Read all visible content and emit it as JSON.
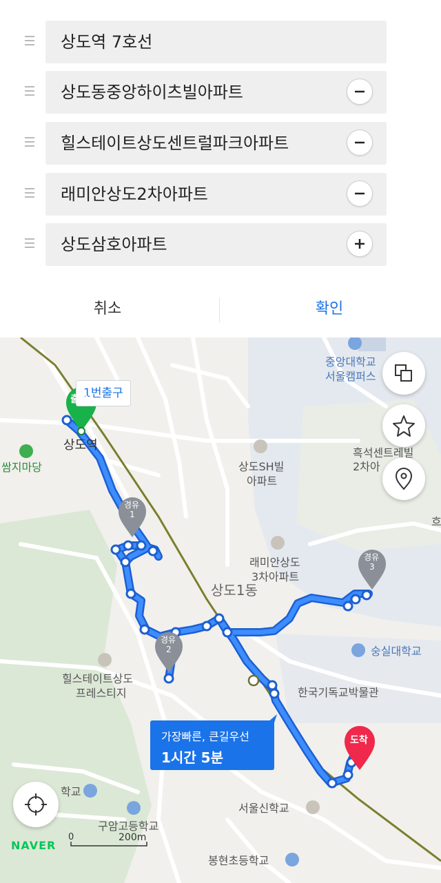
{
  "waypoints": [
    {
      "name": "상도역 7호선",
      "button": ""
    },
    {
      "name": "상도동중앙하이츠빌아파트",
      "button": "minus"
    },
    {
      "name": "힐스테이트상도센트럴파크아파트",
      "button": "minus"
    },
    {
      "name": "래미안상도2차아파트",
      "button": "minus"
    },
    {
      "name": "상도삼호아파트",
      "button": "plus"
    }
  ],
  "actions": {
    "cancel": "취소",
    "confirm": "확인"
  },
  "colors": {
    "accent": "#1a73e8",
    "route": "#1e6ff0",
    "start": "#19b14a",
    "end": "#f0284b",
    "via": "#8a8f98",
    "confirm": "#1a73e8"
  },
  "map": {
    "labels": {
      "exit": "1번출구",
      "station": "상도역",
      "ssamji": "쌈지마당",
      "chungang1": "중앙대학교",
      "chungang2": "서울캠퍼스",
      "heukseok1": "흑석센트레빌",
      "heukseok2": "2차아",
      "sangdo_sh1": "상도SH빌",
      "sangdo_sh2": "아파트",
      "raemian1": "래미안상도",
      "raemian2": "3차아파트",
      "dong": "상도1동",
      "soongsil": "숭실대학교",
      "museum": "한국기독교박물관",
      "hillstate1": "힐스테이트상도",
      "hillstate2": "프레스티지",
      "school1": "학교",
      "guam": "구암고등학교",
      "seoulsin": "서울신학교",
      "bonghyeon": "봉현초등학교",
      "edge_char": "흐"
    },
    "markers": {
      "start": "출발",
      "end": "도착",
      "via_word": "경유",
      "via1": "1",
      "via2": "2",
      "via3": "3"
    },
    "route_info": {
      "line1": "가장빠른, 큰길우선",
      "line2": "1시간 5분"
    },
    "logo": "NAVER",
    "scale": {
      "zero": "0",
      "dist": "200m"
    },
    "icons": [
      "layers-icon",
      "star-icon",
      "location-pin-icon",
      "my-location-icon"
    ]
  }
}
